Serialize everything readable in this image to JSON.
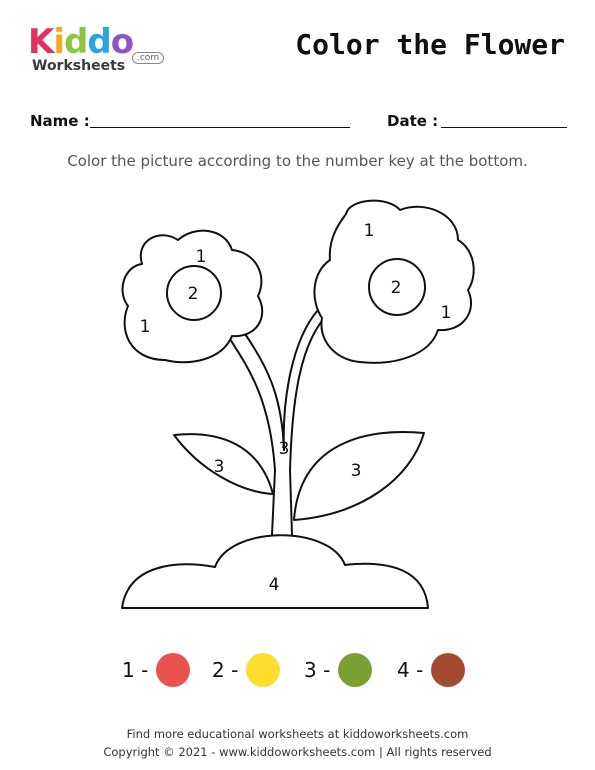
{
  "logo": {
    "letters": [
      {
        "ch": "K",
        "color": "#e2315c"
      },
      {
        "ch": "i",
        "color": "#f6a821"
      },
      {
        "ch": "d",
        "color": "#8cc63f"
      },
      {
        "ch": "d",
        "color": "#2aa4dd"
      },
      {
        "ch": "o",
        "color": "#8e55c7"
      }
    ],
    "subtitle": "Worksheets",
    "domain": ".com"
  },
  "header": {
    "title": "Color the Flower"
  },
  "form": {
    "name_label": "Name :",
    "date_label": "Date :"
  },
  "instruction": "Color the picture according to the number key at the bottom.",
  "picture_numbers": {
    "left_flower_petal_top": "1",
    "left_flower_center": "2",
    "left_flower_petal_left": "1",
    "right_flower_petal_top": "1",
    "right_flower_center": "2",
    "right_flower_petal_right": "1",
    "stem": "3",
    "left_leaf": "3",
    "right_leaf": "3",
    "ground": "4"
  },
  "key": [
    {
      "label": "1 -",
      "color": "#e8524f"
    },
    {
      "label": "2 -",
      "color": "#fdde2e"
    },
    {
      "label": "3 -",
      "color": "#7aa033"
    },
    {
      "label": "4 -",
      "color": "#a34b30"
    }
  ],
  "footer": {
    "line1": "Find more educational worksheets at kiddoworksheets.com",
    "line2": "Copyright © 2021 - www.kiddoworksheets.com  |  All rights reserved"
  }
}
